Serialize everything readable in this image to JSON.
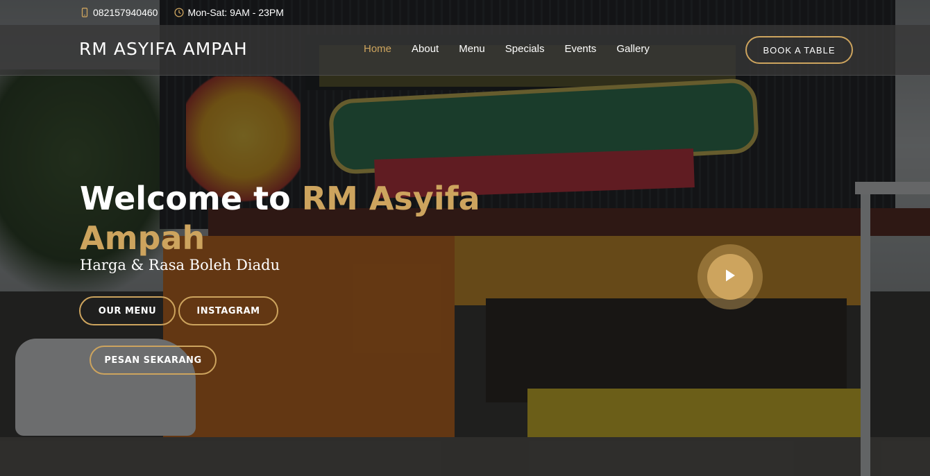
{
  "topbar": {
    "phone": "082157940460",
    "phone_icon": "phone-icon",
    "hours": "Mon-Sat: 9AM - 23PM",
    "hours_icon": "clock-icon"
  },
  "header": {
    "logo": "RM ASYIFA AMPAH",
    "nav": [
      {
        "label": "Home",
        "active": true
      },
      {
        "label": "About"
      },
      {
        "label": "Menu"
      },
      {
        "label": "Specials"
      },
      {
        "label": "Events"
      },
      {
        "label": "Gallery"
      }
    ],
    "book_button": "BOOK A TABLE"
  },
  "hero": {
    "title_prefix": "Welcome to ",
    "title_accent": "RM Asyifa Ampah",
    "subtitle": "Harga & Rasa Boleh Diadu",
    "buttons": {
      "menu": "OUR MENU",
      "instagram": "INSTAGRAM",
      "order": "PESAN SEKARANG"
    },
    "play_icon": "play-icon"
  },
  "colors": {
    "accent": "#cda45e",
    "text": "#ffffff",
    "header_bg": "#373737"
  }
}
